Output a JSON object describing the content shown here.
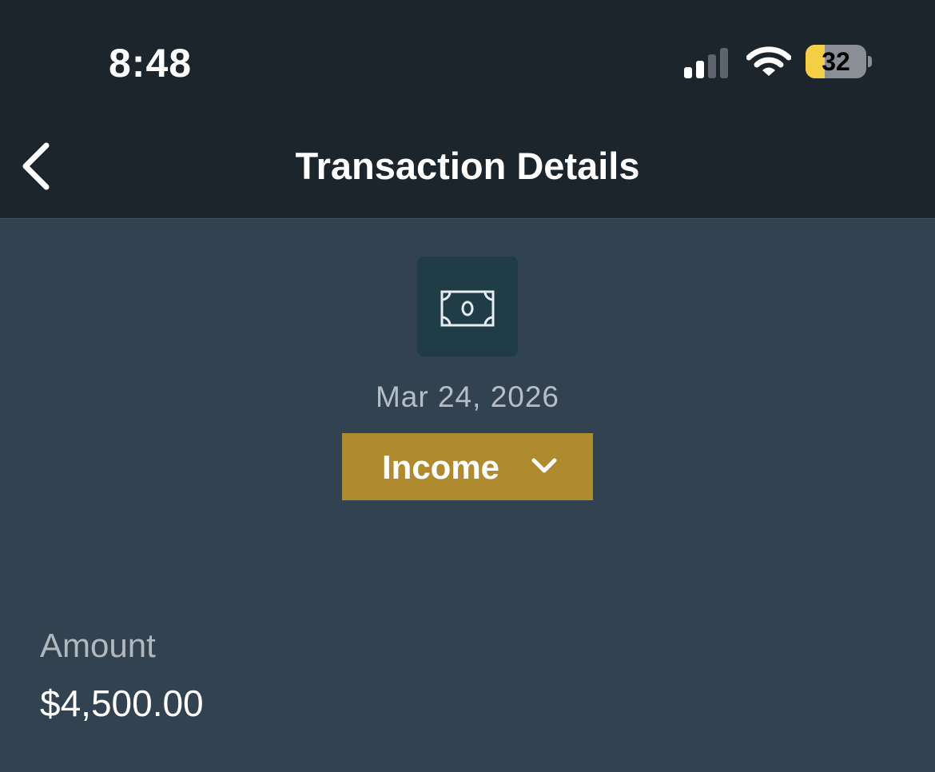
{
  "status_bar": {
    "time": "8:48",
    "signal_icon": "cellular-signal-icon",
    "wifi_icon": "wifi-icon",
    "battery_level": 32,
    "battery_text": "32"
  },
  "header": {
    "back_icon": "chevron-left-icon",
    "title": "Transaction Details"
  },
  "transaction": {
    "icon": "cash-icon",
    "date": "Mar 24, 2026",
    "category": "Income",
    "category_icon": "chevron-down-icon",
    "amount_label": "Amount",
    "amount_value": "$4,500.00"
  },
  "colors": {
    "header_bg": "#1c242c",
    "body_bg": "#324251",
    "icon_tile_bg": "#1f3c47",
    "category_bg": "#b08a2f",
    "battery_fill": "#f4ce45"
  }
}
